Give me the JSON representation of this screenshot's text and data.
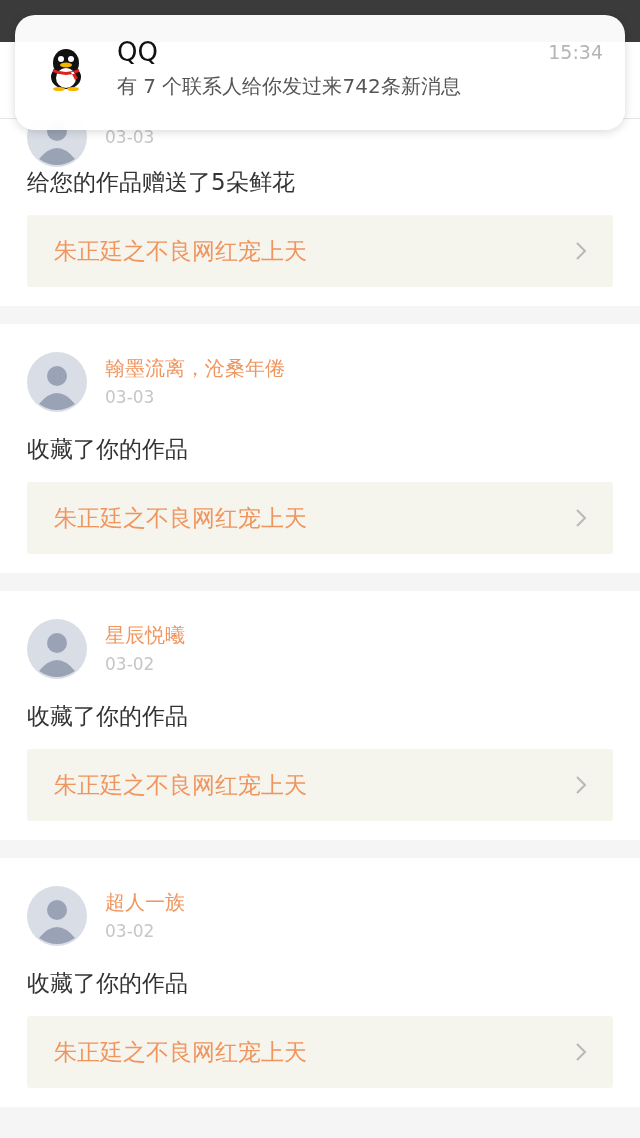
{
  "notification": {
    "app": "QQ",
    "time": "15:34",
    "message": "有 7 个联系人给你发过来742条新消息"
  },
  "items": [
    {
      "date": "03-03",
      "action": "给您的作品赠送了5朵鲜花",
      "work": "朱正廷之不良网红宠上天"
    },
    {
      "name": "翰墨流离，沧桑年倦",
      "date": "03-03",
      "action": "收藏了你的作品",
      "work": "朱正廷之不良网红宠上天"
    },
    {
      "name": "星辰悦曦",
      "date": "03-02",
      "action": "收藏了你的作品",
      "work": "朱正廷之不良网红宠上天"
    },
    {
      "name": "超人一族",
      "date": "03-02",
      "action": "收藏了你的作品",
      "work": "朱正廷之不良网红宠上天"
    }
  ]
}
